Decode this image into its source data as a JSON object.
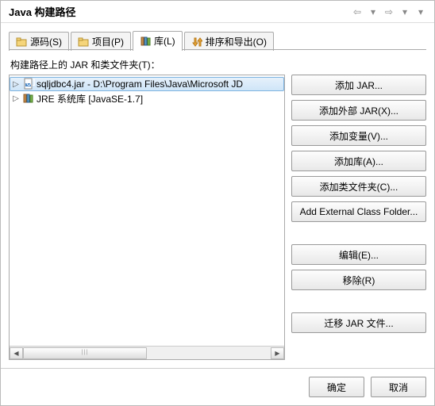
{
  "title": "Java 构建路径",
  "tabs": [
    {
      "icon": "source",
      "label": "源码(S)"
    },
    {
      "icon": "project",
      "label": "项目(P)"
    },
    {
      "icon": "library",
      "label": "库(L)"
    },
    {
      "icon": "order",
      "label": "排序和导出(O)"
    }
  ],
  "section_label": "构建路径上的 JAR 和类文件夹(T)：",
  "tree": [
    {
      "icon": "jar",
      "label": "sqljdbc4.jar - D:\\Program Files\\Java\\Microsoft JD",
      "selected": true
    },
    {
      "icon": "jre-lib",
      "label": "JRE 系统库 [JavaSE-1.7]",
      "selected": false
    }
  ],
  "side_buttons": {
    "group1": [
      "添加 JAR...",
      "添加外部 JAR(X)...",
      "添加变量(V)...",
      "添加库(A)...",
      "添加类文件夹(C)...",
      "Add External Class Folder..."
    ],
    "group2": [
      "编辑(E)...",
      "移除(R)"
    ],
    "group3": [
      "迁移 JAR 文件..."
    ]
  },
  "footer": {
    "ok": "确定",
    "cancel": "取消"
  }
}
